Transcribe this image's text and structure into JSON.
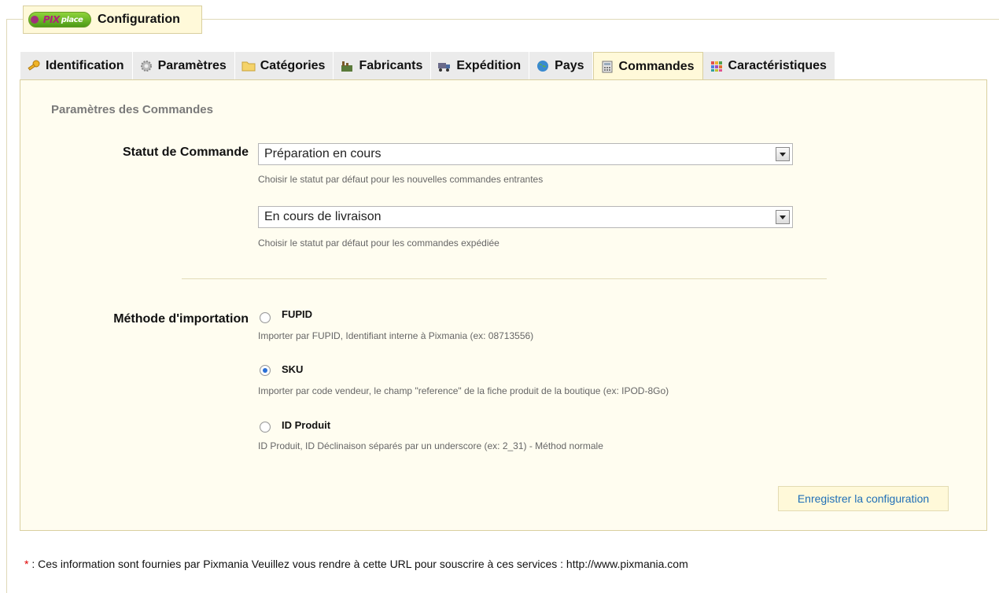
{
  "legend": {
    "logo_pix": "PIX",
    "logo_place": "place",
    "title": "Configuration"
  },
  "tabs": [
    {
      "label": "Identification",
      "icon": "key-icon"
    },
    {
      "label": "Paramètres",
      "icon": "gear-icon"
    },
    {
      "label": "Catégories",
      "icon": "folder-icon"
    },
    {
      "label": "Fabricants",
      "icon": "factory-icon"
    },
    {
      "label": "Expédition",
      "icon": "truck-icon"
    },
    {
      "label": "Pays",
      "icon": "globe-icon"
    },
    {
      "label": "Commandes",
      "icon": "calculator-icon",
      "active": true
    },
    {
      "label": "Caractéristiques",
      "icon": "grid-icon"
    }
  ],
  "panel": {
    "section_title": "Paramètres des Commandes",
    "order_status": {
      "label": "Statut de Commande",
      "select1_value": "Préparation en cours",
      "select1_help": "Choisir le statut par défaut pour les nouvelles commandes entrantes",
      "select2_value": "En cours de livraison",
      "select2_help": "Choisir le statut par défaut pour les commandes expédiée"
    },
    "import_method": {
      "label": "Méthode d'importation",
      "options": [
        {
          "label": "FUPID",
          "help": "Importer par FUPID, Identifiant interne à Pixmania (ex: 08713556)",
          "checked": false
        },
        {
          "label": "SKU",
          "help": "Importer par code vendeur, le champ \"reference\" de la fiche produit de la boutique (ex: IPOD-8Go)",
          "checked": true
        },
        {
          "label": "ID Produit",
          "help": "ID Produit, ID Déclinaison séparés par un underscore (ex: 2_31) - Méthod normale",
          "checked": false
        }
      ]
    },
    "save_button": "Enregistrer la configuration"
  },
  "footnote": {
    "star": "*",
    "text": " : Ces information sont fournies par Pixmania Veuillez vous rendre à cette URL pour souscrire à ces services : http://www.pixmania.com"
  },
  "colors": {
    "accent_bg": "#fff9d9",
    "link": "#1f6fb7",
    "required_star": "#e00000"
  }
}
